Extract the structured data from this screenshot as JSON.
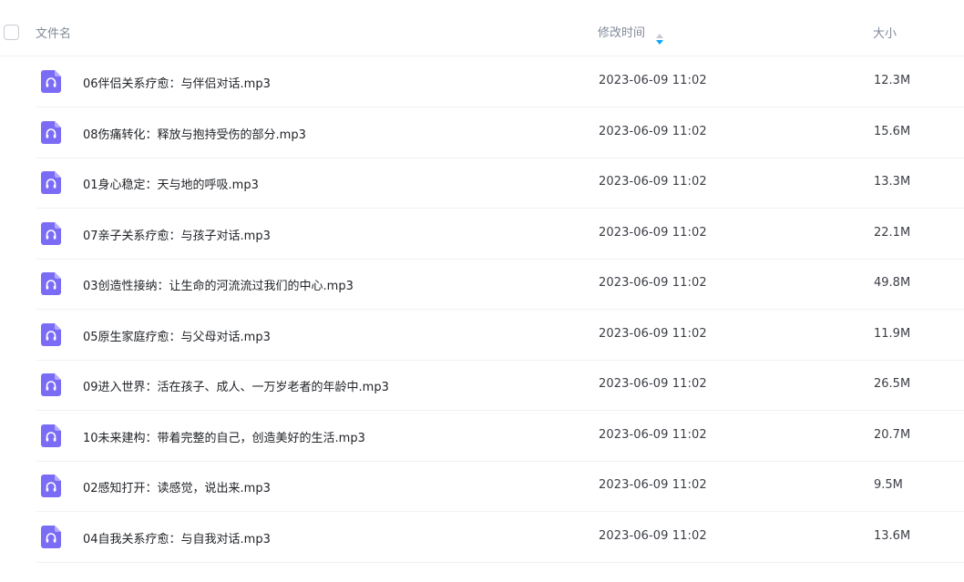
{
  "header": {
    "name_label": "文件名",
    "time_label": "修改时间",
    "size_label": "大小"
  },
  "colors": {
    "icon_purple": "#7b6cf6",
    "sort_active": "#06a7ff",
    "divider": "#f1f2f4"
  },
  "rows": [
    {
      "icon": "audio-file-icon",
      "name": "06伴侣关系疗愈：与伴侣对话.mp3",
      "time": "2023-06-09 11:02",
      "size": "12.3M"
    },
    {
      "icon": "audio-file-icon",
      "name": "08伤痛转化：释放与抱持受伤的部分.mp3",
      "time": "2023-06-09 11:02",
      "size": "15.6M"
    },
    {
      "icon": "audio-file-icon",
      "name": "01身心稳定：天与地的呼吸.mp3",
      "time": "2023-06-09 11:02",
      "size": "13.3M"
    },
    {
      "icon": "audio-file-icon",
      "name": "07亲子关系疗愈：与孩子对话.mp3",
      "time": "2023-06-09 11:02",
      "size": "22.1M"
    },
    {
      "icon": "audio-file-icon",
      "name": "03创造性接纳：让生命的河流流过我们的中心.mp3",
      "time": "2023-06-09 11:02",
      "size": "49.8M"
    },
    {
      "icon": "audio-file-icon",
      "name": "05原生家庭疗愈：与父母对话.mp3",
      "time": "2023-06-09 11:02",
      "size": "11.9M"
    },
    {
      "icon": "audio-file-icon",
      "name": "09进入世界：活在孩子、成人、一万岁老者的年龄中.mp3",
      "time": "2023-06-09 11:02",
      "size": "26.5M"
    },
    {
      "icon": "audio-file-icon",
      "name": "10未来建构：带着完整的自己，创造美好的生活.mp3",
      "time": "2023-06-09 11:02",
      "size": "20.7M"
    },
    {
      "icon": "audio-file-icon",
      "name": "02感知打开：读感觉，说出来.mp3",
      "time": "2023-06-09 11:02",
      "size": "9.5M"
    },
    {
      "icon": "audio-file-icon",
      "name": "04自我关系疗愈：与自我对话.mp3",
      "time": "2023-06-09 11:02",
      "size": "13.6M"
    }
  ]
}
